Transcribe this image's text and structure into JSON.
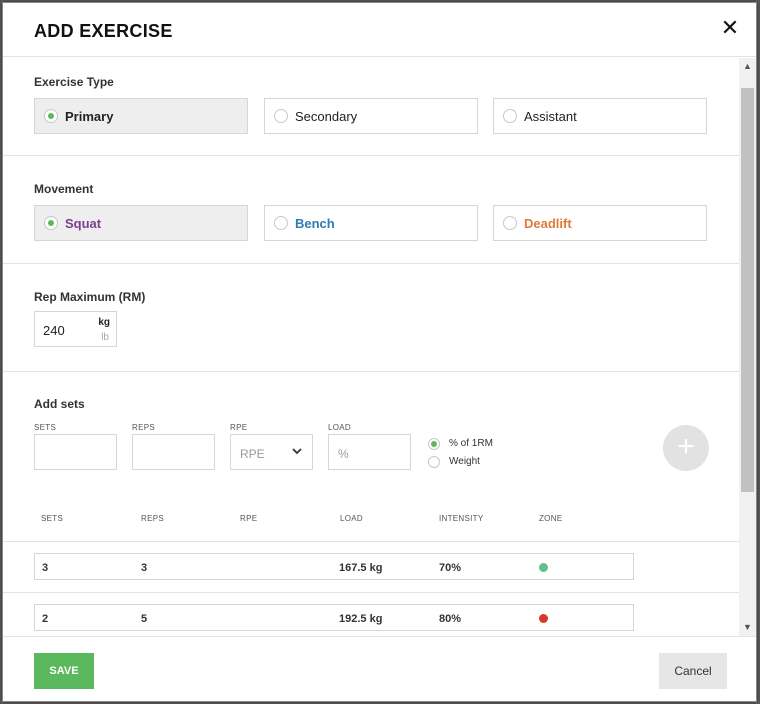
{
  "header": {
    "title": "ADD EXERCISE",
    "close_glyph": "✕"
  },
  "exercise_type": {
    "title": "Exercise Type",
    "options": [
      {
        "label": "Primary",
        "selected": true
      },
      {
        "label": "Secondary",
        "selected": false
      },
      {
        "label": "Assistant",
        "selected": false
      }
    ]
  },
  "movement": {
    "title": "Movement",
    "options": [
      {
        "label": "Squat",
        "color": "#7b3f8f",
        "selected": true
      },
      {
        "label": "Bench",
        "color": "#2e7bb0",
        "selected": false
      },
      {
        "label": "Deadlift",
        "color": "#e07a3a",
        "selected": false
      }
    ]
  },
  "rep_max": {
    "title": "Rep Maximum (RM)",
    "value": "240",
    "unit_kg": "kg",
    "unit_lb": "lb"
  },
  "add_sets": {
    "title": "Add sets",
    "labels": {
      "sets": "SETS",
      "reps": "REPS",
      "rpe": "RPE",
      "load": "LOAD"
    },
    "rpe_placeholder": "RPE",
    "load_placeholder": "%",
    "load_mode": [
      {
        "label": "% of 1RM",
        "selected": true
      },
      {
        "label": "Weight",
        "selected": false
      }
    ],
    "add_glyph": "+"
  },
  "table": {
    "headers": [
      "SETS",
      "REPS",
      "RPE",
      "LOAD",
      "INTENSITY",
      "ZONE"
    ],
    "rows": [
      {
        "sets": "3",
        "reps": "3",
        "rpe": "",
        "load": "167.5 kg",
        "intensity": "70%",
        "zone_color": "#5ec18e"
      },
      {
        "sets": "2",
        "reps": "5",
        "rpe": "",
        "load": "192.5 kg",
        "intensity": "80%",
        "zone_color": "#d9362c"
      }
    ]
  },
  "footer": {
    "save_label": "SAVE",
    "cancel_label": "Cancel"
  },
  "scrollbar": {
    "up_glyph": "▲",
    "down_glyph": "▼"
  }
}
